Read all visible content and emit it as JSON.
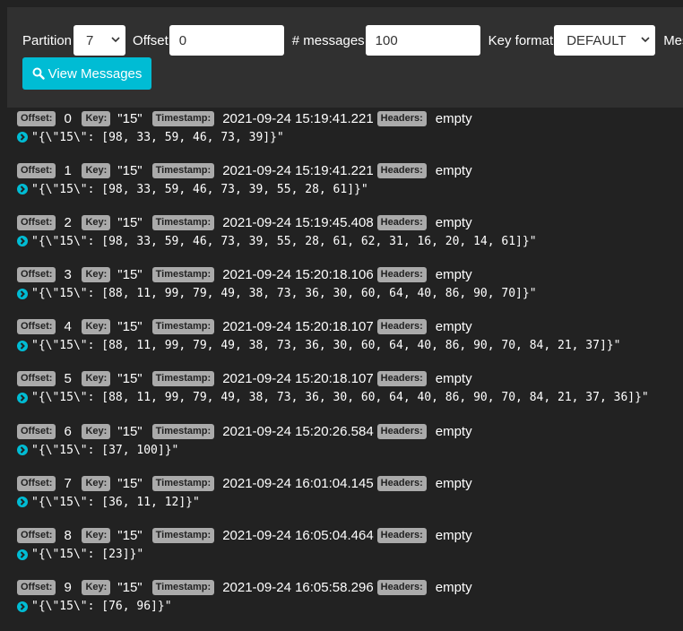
{
  "toolbar": {
    "partition_label": "Partition",
    "partition_value": "7",
    "offset_label": "Offset",
    "offset_value": "0",
    "count_label": "# messages",
    "count_value": "100",
    "keyformat_label": "Key format",
    "keyformat_value": "DEFAULT",
    "message_format_label_truncated": "Mes",
    "view_button_label": "View Messages"
  },
  "labels": {
    "offset": "Offset:",
    "key": "Key:",
    "timestamp": "Timestamp:",
    "headers": "Headers:"
  },
  "messages": [
    {
      "offset": "0",
      "key": "\"15\"",
      "timestamp": "2021-09-24 15:19:41.221",
      "headers": "empty",
      "value": "\"{\\\"15\\\": [98, 33, 59, 46, 73, 39]}\""
    },
    {
      "offset": "1",
      "key": "\"15\"",
      "timestamp": "2021-09-24 15:19:41.221",
      "headers": "empty",
      "value": "\"{\\\"15\\\": [98, 33, 59, 46, 73, 39, 55, 28, 61]}\""
    },
    {
      "offset": "2",
      "key": "\"15\"",
      "timestamp": "2021-09-24 15:19:45.408",
      "headers": "empty",
      "value": "\"{\\\"15\\\": [98, 33, 59, 46, 73, 39, 55, 28, 61, 62, 31, 16, 20, 14, 61]}\""
    },
    {
      "offset": "3",
      "key": "\"15\"",
      "timestamp": "2021-09-24 15:20:18.106",
      "headers": "empty",
      "value": "\"{\\\"15\\\": [88, 11, 99, 79, 49, 38, 73, 36, 30, 60, 64, 40, 86, 90, 70]}\""
    },
    {
      "offset": "4",
      "key": "\"15\"",
      "timestamp": "2021-09-24 15:20:18.107",
      "headers": "empty",
      "value": "\"{\\\"15\\\": [88, 11, 99, 79, 49, 38, 73, 36, 30, 60, 64, 40, 86, 90, 70, 84, 21, 37]}\""
    },
    {
      "offset": "5",
      "key": "\"15\"",
      "timestamp": "2021-09-24 15:20:18.107",
      "headers": "empty",
      "value": "\"{\\\"15\\\": [88, 11, 99, 79, 49, 38, 73, 36, 30, 60, 64, 40, 86, 90, 70, 84, 21, 37, 36]}\""
    },
    {
      "offset": "6",
      "key": "\"15\"",
      "timestamp": "2021-09-24 15:20:26.584",
      "headers": "empty",
      "value": "\"{\\\"15\\\": [37, 100]}\""
    },
    {
      "offset": "7",
      "key": "\"15\"",
      "timestamp": "2021-09-24 16:01:04.145",
      "headers": "empty",
      "value": "\"{\\\"15\\\": [36, 11, 12]}\""
    },
    {
      "offset": "8",
      "key": "\"15\"",
      "timestamp": "2021-09-24 16:05:04.464",
      "headers": "empty",
      "value": "\"{\\\"15\\\": [23]}\""
    },
    {
      "offset": "9",
      "key": "\"15\"",
      "timestamp": "2021-09-24 16:05:58.296",
      "headers": "empty",
      "value": "\"{\\\"15\\\": [76, 96]}\""
    }
  ],
  "colors": {
    "accent": "#00bcd4",
    "badge": "#aaaaaa",
    "background": "#222222",
    "panel": "#303030"
  },
  "icons": {
    "view_button": "search-icon",
    "row_toggle": "chevron-right-circle-icon",
    "select_arrow": "chevron-down-icon"
  }
}
